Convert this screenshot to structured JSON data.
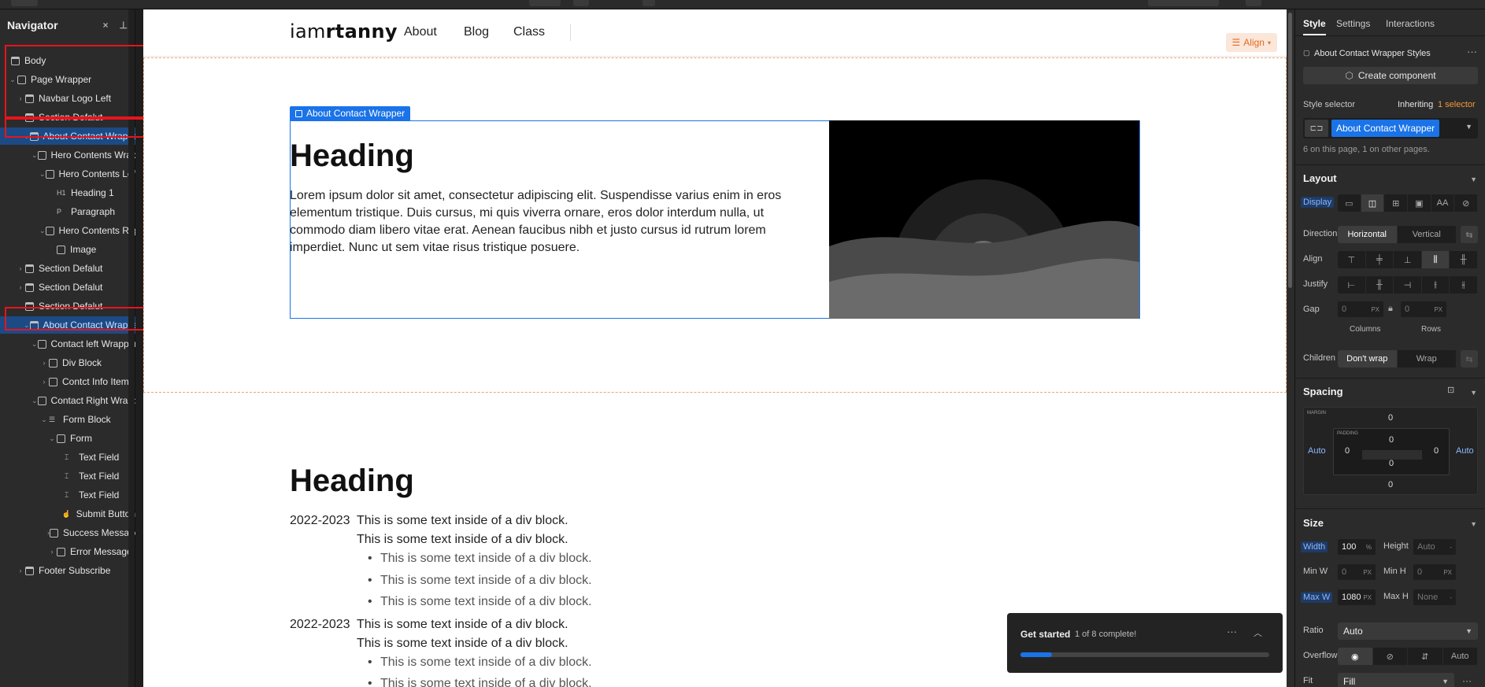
{
  "navigator": {
    "title": "Navigator",
    "close_label": "×",
    "pin_label": "⊥",
    "items": [
      {
        "label": "Body"
      },
      {
        "label": "Page Wrapper"
      },
      {
        "label": "Navbar Logo Left"
      },
      {
        "label": "Section Defalut"
      },
      {
        "label": "About Contact Wrapper"
      },
      {
        "label": "Hero Contents Wrapper"
      },
      {
        "label": "Hero Contents Left"
      },
      {
        "label": "Heading 1"
      },
      {
        "label": "Paragraph"
      },
      {
        "label": "Hero Contents Right"
      },
      {
        "label": "Image"
      },
      {
        "label": "Section Defalut"
      },
      {
        "label": "Section Defalut"
      },
      {
        "label": "Section Defalut"
      },
      {
        "label": "About Contact Wrapper"
      },
      {
        "label": "Contact left Wrapper"
      },
      {
        "label": "Div Block"
      },
      {
        "label": "Contct Info Item"
      },
      {
        "label": "Contact Right Wrapper"
      },
      {
        "label": "Form Block"
      },
      {
        "label": "Form"
      },
      {
        "label": "Text Field"
      },
      {
        "label": "Text Field"
      },
      {
        "label": "Text Field"
      },
      {
        "label": "Submit Button"
      },
      {
        "label": "Success Message"
      },
      {
        "label": "Error Message"
      },
      {
        "label": "Footer Subscribe"
      }
    ]
  },
  "canvas": {
    "logo_light": "iam",
    "logo_bold": "rtanny",
    "nav_links": [
      "About",
      "Blog",
      "Class"
    ],
    "align_label": "Align",
    "selection_label": "About Contact Wrapper",
    "heading1": "Heading",
    "paragraph": "Lorem ipsum dolor sit amet, consectetur adipiscing elit. Suspendisse varius enim in eros elementum tristique. Duis cursus, mi quis viverra ornare, eros dolor interdum nulla, ut commodo diam libero vitae erat. Aenean faucibus nibh et justo cursus id rutrum lorem imperdiet. Nunc ut sem vitae risus tristique posuere.",
    "heading2": "Heading",
    "year": "2022-2023",
    "div_text": "This is some text inside of a div block."
  },
  "get_started": {
    "title": "Get started",
    "progress_text": "1 of 8 complete!",
    "more": "···",
    "progress": 0.125
  },
  "panel": {
    "tabs": [
      "Style",
      "Settings",
      "Interactions"
    ],
    "styles_title": "About Contact Wrapper Styles",
    "more": "···",
    "create_component": "Create component",
    "style_selector_label": "Style selector",
    "inheriting": "Inheriting",
    "inheriting_count": "1 selector",
    "selector_chip": "About Contact Wrapper",
    "selector_note": "6 on this page, 1 on other pages.",
    "layout": {
      "title": "Layout",
      "display": "Display",
      "display_aa": "AA",
      "direction": "Direction",
      "horizontal": "Horizontal",
      "vertical": "Vertical",
      "align": "Align",
      "justify": "Justify",
      "gap": "Gap",
      "gap_col": "0",
      "gap_row": "0",
      "unit": "PX",
      "columns": "Columns",
      "rows": "Rows",
      "children": "Children",
      "dont_wrap": "Don't wrap",
      "wrap": "Wrap"
    },
    "spacing": {
      "title": "Spacing",
      "margin_label": "MARGIN",
      "padding_label": "PADDING",
      "margin_top": "0",
      "margin_bottom": "0",
      "margin_left": "Auto",
      "margin_right": "Auto",
      "padding_top": "0",
      "padding_bottom": "0",
      "padding_left": "0",
      "padding_right": "0"
    },
    "size": {
      "title": "Size",
      "width": "Width",
      "width_val": "100",
      "width_unit": "%",
      "height": "Height",
      "height_val": "Auto",
      "height_unit": "-",
      "min_w": "Min W",
      "min_w_val": "0",
      "min_h": "Min H",
      "min_h_val": "0",
      "max_w": "Max W",
      "max_w_val": "1080",
      "max_h": "Max H",
      "max_h_val": "None",
      "unit": "PX",
      "ratio": "Ratio",
      "ratio_val": "Auto",
      "overflow": "Overflow",
      "overflow_auto": "Auto",
      "fit": "Fit",
      "fit_val": "Fill"
    }
  },
  "colors": {
    "accent": "#1a73e8",
    "highlight_box": "#e8141c",
    "orange": "#e36a1f"
  }
}
